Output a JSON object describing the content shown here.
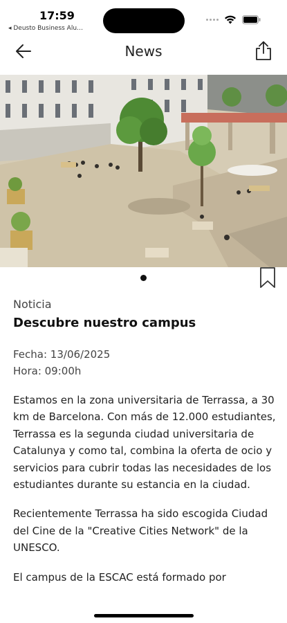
{
  "status_bar": {
    "time": "17:59",
    "back_app": "◂ Deusto Business Alu…"
  },
  "nav": {
    "title": "News",
    "back_icon": "arrow-left-icon",
    "share_icon": "share-icon"
  },
  "carousel": {
    "image_description_icon": "campus-courtyard-photo",
    "page_count": 1,
    "current_page": 1
  },
  "article": {
    "category": "Noticia",
    "title": "Descubre nuestro campus",
    "date_line": "Fecha: 13/06/2025",
    "time_line": "Hora: 09:00h",
    "paragraphs": [
      "Estamos en la zona universitaria de Terrassa, a 30 km de Barcelona. Con más de 12.000 estudiantes, Terrassa es la segunda ciudad universitaria de Catalunya y como tal, combina la oferta de ocio y servicios para cubrir todas las necesidades de los estudiantes durante su estancia en la ciudad.",
      "Recientemente Terrassa ha sido escogida Ciudad del Cine de la \"Creative Cities Network\" de la UNESCO.",
      "El campus de la ESCAC está formado por"
    ]
  },
  "colors": {
    "text_primary": "#111111",
    "text_secondary": "#444444",
    "background": "#ffffff"
  }
}
